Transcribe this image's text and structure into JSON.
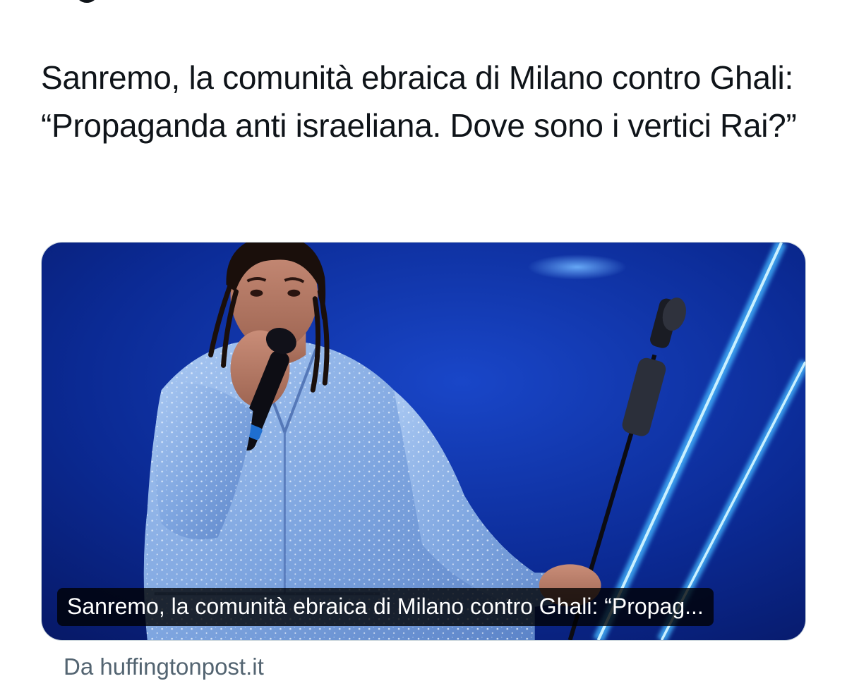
{
  "tweet": {
    "text": "Sanremo, la comunità ebraica di Milano contro Ghali: “Propaganda anti israeliana. Dove sono i vertici Rai?”"
  },
  "card": {
    "title": "Sanremo, la comunità ebraica di Milano contro Ghali: “Propag...",
    "source": "Da huffingtonpost.it",
    "background_color": "#0a2a8a",
    "accent_color": "#4fc3ff"
  }
}
